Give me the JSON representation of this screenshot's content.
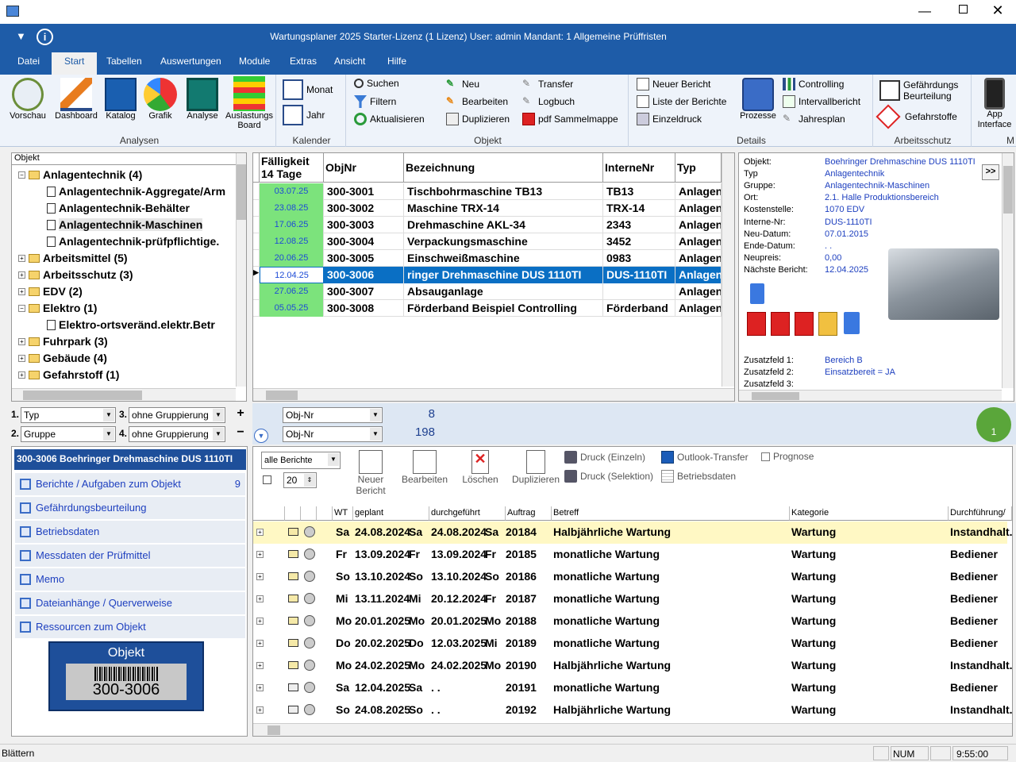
{
  "app": {
    "title": "Wartungsplaner 2025 Starter-Lizenz (1 Lizenz)   User: admin   Mandant: 1 Allgemeine Prüffristen",
    "menu": [
      "Datei",
      "Start",
      "Tabellen",
      "Auswertungen",
      "Module",
      "Extras",
      "Ansicht",
      "Hilfe"
    ],
    "active_menu": "Start"
  },
  "ribbon": {
    "analysen": {
      "label": "Analysen",
      "buttons": [
        "Vorschau",
        "Dashboard",
        "Katalog",
        "Grafik",
        "Analyse",
        "Auslastungs Board"
      ]
    },
    "kalender": {
      "label": "Kalender",
      "buttons": [
        "Monat",
        "Jahr"
      ]
    },
    "objekt": {
      "label": "Objekt",
      "buttons": [
        "Suchen",
        "Filtern",
        "Aktualisieren",
        "Neu",
        "Bearbeiten",
        "Duplizieren",
        "Transfer",
        "Logbuch",
        "pdf Sammelmappe"
      ]
    },
    "details": {
      "label": "Details",
      "buttons": [
        "Neuer Bericht",
        "Liste der Berichte",
        "Einzeldruck",
        "Prozesse",
        "Controlling",
        "Intervallbericht",
        "Jahresplan"
      ]
    },
    "arbeitsschutz": {
      "label": "Arbeitsschutz",
      "buttons": [
        "Gefährdungs Beurteilung",
        "Gefahrstoffe"
      ]
    },
    "m": {
      "label": "M",
      "buttons": [
        "App Interface"
      ]
    }
  },
  "tree": {
    "header": "Objekt",
    "nodes": [
      {
        "label": "Anlagentechnik  (4)",
        "level": 0,
        "type": "folder-open",
        "toggle": "−"
      },
      {
        "label": "Anlagentechnik-Aggregate/Arm",
        "level": 1,
        "type": "doc"
      },
      {
        "label": "Anlagentechnik-Behälter",
        "level": 1,
        "type": "doc"
      },
      {
        "label": "Anlagentechnik-Maschinen",
        "level": 1,
        "type": "doc"
      },
      {
        "label": "Anlagentechnik-prüfpflichtige.",
        "level": 1,
        "type": "doc"
      },
      {
        "label": "Arbeitsmittel  (5)",
        "level": 0,
        "type": "folder",
        "toggle": "+"
      },
      {
        "label": "Arbeitsschutz  (3)",
        "level": 0,
        "type": "folder",
        "toggle": "+"
      },
      {
        "label": "EDV  (2)",
        "level": 0,
        "type": "folder",
        "toggle": "+"
      },
      {
        "label": "Elektro  (1)",
        "level": 0,
        "type": "folder-open",
        "toggle": "−"
      },
      {
        "label": "Elektro-ortsveränd.elektr.Betr",
        "level": 1,
        "type": "doc"
      },
      {
        "label": "Fuhrpark  (3)",
        "level": 0,
        "type": "folder",
        "toggle": "+"
      },
      {
        "label": "Gebäude  (4)",
        "level": 0,
        "type": "folder",
        "toggle": "+"
      },
      {
        "label": "Gefahrstoff  (1)",
        "level": 0,
        "type": "folder",
        "toggle": "+"
      }
    ]
  },
  "grid": {
    "headers": [
      "Fälligkeit 14 Tage",
      "ObjNr",
      "Bezeichnung",
      "InterneNr",
      "Typ"
    ],
    "rows": [
      {
        "due": "03.07.25",
        "nr": "300-3001",
        "name": "Tischbohrmaschine TB13",
        "internal": "TB13",
        "typ": "Anlagen"
      },
      {
        "due": "23.08.25",
        "nr": "300-3002",
        "name": "Maschine TRX-14",
        "internal": "TRX-14",
        "typ": "Anlagen"
      },
      {
        "due": "17.06.25",
        "nr": "300-3003",
        "name": "Drehmaschine AKL-34",
        "internal": "2343",
        "typ": "Anlagen"
      },
      {
        "due": "12.08.25",
        "nr": "300-3004",
        "name": "Verpackungsmaschine",
        "internal": "3452",
        "typ": "Anlagen"
      },
      {
        "due": "20.06.25",
        "nr": "300-3005",
        "name": "Einschweißmaschine",
        "internal": "0983",
        "typ": "Anlagen"
      },
      {
        "due": "12.04.25",
        "nr": "300-3006",
        "name": "ringer Drehmaschine DUS 1110TI",
        "internal": "DUS-1110TI",
        "typ": "Anlagen",
        "selected": true
      },
      {
        "due": "27.06.25",
        "nr": "300-3007",
        "name": "Absauganlage",
        "internal": "",
        "typ": "Anlagen"
      },
      {
        "due": "05.05.25",
        "nr": "300-3008",
        "name": "Förderband Beispiel Controlling",
        "internal": "Förderband",
        "typ": "Anlagen"
      }
    ]
  },
  "detail": {
    "fields": [
      {
        "label": "Objekt:",
        "value": "Boehringer Drehmaschine DUS 1110TI"
      },
      {
        "label": "Typ",
        "value": "Anlagentechnik"
      },
      {
        "label": "Gruppe:",
        "value": "Anlagentechnik-Maschinen"
      },
      {
        "label": "Ort:",
        "value": "2.1. Halle Produktionsbereich"
      },
      {
        "label": "Kostenstelle:",
        "value": "1070 EDV"
      },
      {
        "label": "Interne-Nr:",
        "value": "DUS-1110TI"
      },
      {
        "label": "Neu-Datum:",
        "value": "07.01.2015"
      },
      {
        "label": "Ende-Datum:",
        "value": ". ."
      },
      {
        "label": "Neupreis:",
        "value": "0,00"
      },
      {
        "label": "Nächste Bericht:",
        "value": "12.04.2025"
      }
    ],
    "extra": [
      {
        "label": "Zusatzfeld 1:",
        "value": "Bereich B"
      },
      {
        "label": "Zusatzfeld 2:",
        "value": "Einsatzbereit = JA"
      },
      {
        "label": "Zusatzfeld 3:",
        "value": ""
      }
    ],
    "expand": ">>"
  },
  "groupbar": {
    "g1n": "1.",
    "g1": "Typ",
    "g2n": "2.",
    "g2": "Gruppe",
    "g3n": "3.",
    "g3": "ohne Gruppierung",
    "g4n": "4.",
    "g4": "ohne Gruppierung",
    "plus": "+",
    "minus": "−",
    "sort1": "Obj-Nr",
    "sort2": "Obj-Nr",
    "count1": "8",
    "count2": "198",
    "badge": "1"
  },
  "leftpanel": {
    "title": "300-3006 Boehringer Drehmaschine DUS 1110TI",
    "links": [
      {
        "label": "Berichte / Aufgaben zum Objekt",
        "count": "9"
      },
      {
        "label": "Gefährdungsbeurteilung",
        "count": ""
      },
      {
        "label": "Betriebsdaten",
        "count": ""
      },
      {
        "label": "Messdaten der Prüfmittel",
        "count": ""
      },
      {
        "label": "Memo",
        "count": ""
      },
      {
        "label": "Dateianhänge / Querverweise",
        "count": ""
      },
      {
        "label": "Ressourcen zum Objekt",
        "count": ""
      }
    ],
    "barcode_title": "Objekt",
    "barcode_value": "300-3006"
  },
  "reports": {
    "filter": "alle Berichte",
    "limit": "20",
    "buttons": [
      "Neuer Bericht",
      "Bearbeiten",
      "Löschen",
      "Duplizieren"
    ],
    "side": [
      "Druck (Einzeln)",
      "Druck (Selektion)",
      "Outlook-Transfer",
      "Betriebsdaten",
      "Prognose"
    ],
    "headers": [
      "WT",
      "geplant",
      "durchgeführt",
      "Auftrag",
      "Betreff",
      "Kategorie",
      "Durchführung/"
    ],
    "rows": [
      {
        "wt": "Sa",
        "plan": "24.08.2024",
        "wt2": "Sa",
        "done": "24.08.2024",
        "wt3": "Sa",
        "auftrag": "20184",
        "betreff": "Halbjährliche Wartung",
        "kat": "Wartung",
        "durch": "Instandhalt.",
        "open": false,
        "highlight": true
      },
      {
        "wt": "Fr",
        "plan": "13.09.2024",
        "wt2": "Fr",
        "done": "13.09.2024",
        "wt3": "Fr",
        "auftrag": "20185",
        "betreff": "monatliche Wartung",
        "kat": "Wartung",
        "durch": "Bediener",
        "open": false
      },
      {
        "wt": "So",
        "plan": "13.10.2024",
        "wt2": "So",
        "done": "13.10.2024",
        "wt3": "So",
        "auftrag": "20186",
        "betreff": "monatliche Wartung",
        "kat": "Wartung",
        "durch": "Bediener",
        "open": false
      },
      {
        "wt": "Mi",
        "plan": "13.11.2024",
        "wt2": "Mi",
        "done": "20.12.2024",
        "wt3": "Fr",
        "auftrag": "20187",
        "betreff": "monatliche Wartung",
        "kat": "Wartung",
        "durch": "Bediener",
        "open": false
      },
      {
        "wt": "Mo",
        "plan": "20.01.2025",
        "wt2": "Mo",
        "done": "20.01.2025",
        "wt3": "Mo",
        "auftrag": "20188",
        "betreff": "monatliche Wartung",
        "kat": "Wartung",
        "durch": "Bediener",
        "open": false
      },
      {
        "wt": "Do",
        "plan": "20.02.2025",
        "wt2": "Do",
        "done": "12.03.2025",
        "wt3": "Mi",
        "auftrag": "20189",
        "betreff": "monatliche Wartung",
        "kat": "Wartung",
        "durch": "Bediener",
        "open": false
      },
      {
        "wt": "Mo",
        "plan": "24.02.2025",
        "wt2": "Mo",
        "done": "24.02.2025",
        "wt3": "Mo",
        "auftrag": "20190",
        "betreff": "Halbjährliche Wartung",
        "kat": "Wartung",
        "durch": "Instandhalt.",
        "open": false
      },
      {
        "wt": "Sa",
        "plan": "12.04.2025",
        "wt2": "Sa",
        "done": ". .",
        "wt3": "",
        "auftrag": "20191",
        "betreff": "monatliche Wartung",
        "kat": "Wartung",
        "durch": "Bediener",
        "open": true
      },
      {
        "wt": "So",
        "plan": "24.08.2025",
        "wt2": "So",
        "done": ". .",
        "wt3": "",
        "auftrag": "20192",
        "betreff": "Halbjährliche Wartung",
        "kat": "Wartung",
        "durch": "Instandhalt.",
        "open": true
      }
    ]
  },
  "status": {
    "left": "Blättern",
    "num": "NUM",
    "time": "9:55:00"
  },
  "colors": {
    "accent": "#1e5ca8",
    "due": "#7ce37c",
    "selected": "#0a6fc4",
    "highlight": "#fff8c4"
  }
}
